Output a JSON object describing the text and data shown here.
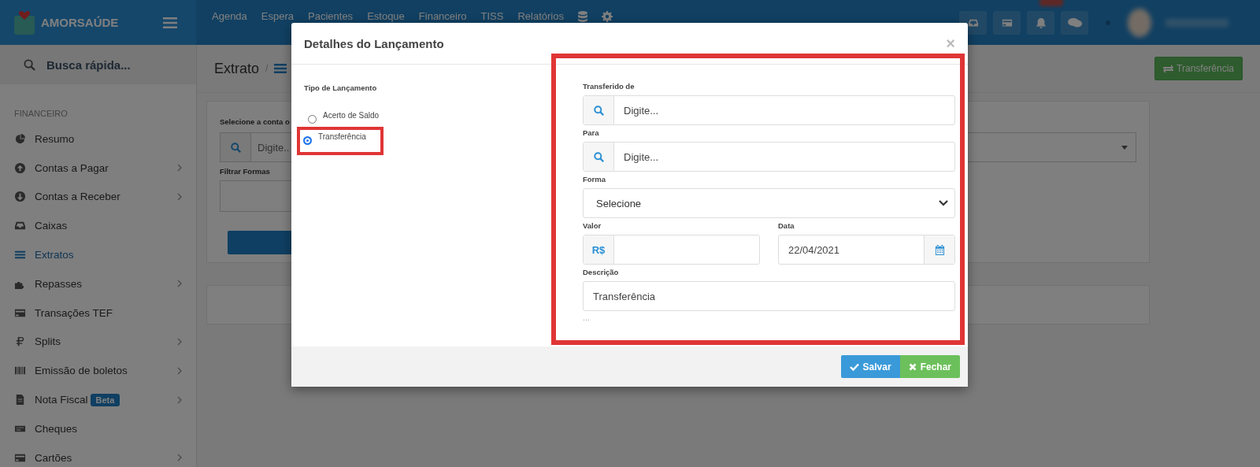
{
  "brand": {
    "name": "AMORSAÚDE"
  },
  "top_nav": [
    "Agenda",
    "Espera",
    "Pacientes",
    "Estoque",
    "Financeiro",
    "TISS",
    "Relatórios"
  ],
  "sidebar": {
    "search_placeholder": "Busca rápida...",
    "section": "FINANCEIRO",
    "items": [
      {
        "label": "Resumo",
        "submenu": false,
        "selected": false
      },
      {
        "label": "Contas a Pagar",
        "submenu": true,
        "selected": false
      },
      {
        "label": "Contas a Receber",
        "submenu": true,
        "selected": false
      },
      {
        "label": "Caixas",
        "submenu": false,
        "selected": false
      },
      {
        "label": "Extratos",
        "submenu": false,
        "selected": true
      },
      {
        "label": "Repasses",
        "submenu": true,
        "selected": false
      },
      {
        "label": "Transações TEF",
        "submenu": false,
        "selected": false
      },
      {
        "label": "Splits",
        "submenu": true,
        "selected": false
      },
      {
        "label": "Emissão de boletos",
        "submenu": true,
        "selected": false
      },
      {
        "label": "Nota Fiscal",
        "badge": "Beta",
        "submenu": true,
        "selected": false
      },
      {
        "label": "Cheques",
        "submenu": false,
        "selected": false
      },
      {
        "label": "Cartões",
        "submenu": true,
        "selected": false
      }
    ]
  },
  "page": {
    "title": "Extrato",
    "separator": "/",
    "action": "Transferência",
    "account_label": "Selecione a conta o",
    "account_placeholder": "Digite..",
    "forms_label": "Filtrar Formas"
  },
  "modal": {
    "title": "Detalhes do Lançamento",
    "close": "×",
    "type_label": "Tipo de Lançamento",
    "types": [
      {
        "label": "Acerto de Saldo",
        "selected": false
      },
      {
        "label": "Transferência",
        "selected": true
      }
    ],
    "fields": [
      {
        "kind": "search",
        "label": "Transferido de",
        "placeholder": "Digite..."
      },
      {
        "kind": "search",
        "label": "Para",
        "placeholder": "Digite..."
      },
      {
        "kind": "select",
        "label": "Forma",
        "value": "Selecione"
      },
      {
        "kind": "currency",
        "label": "Valor",
        "addon": "R$"
      },
      {
        "kind": "date",
        "label": "Data",
        "value": "22/04/2021"
      },
      {
        "kind": "text",
        "label": "Descrição",
        "value": "Transferência"
      }
    ],
    "more": "...",
    "buttons": [
      {
        "kind": "save",
        "label": "Salvar"
      },
      {
        "kind": "close",
        "label": "Fechar"
      }
    ]
  }
}
